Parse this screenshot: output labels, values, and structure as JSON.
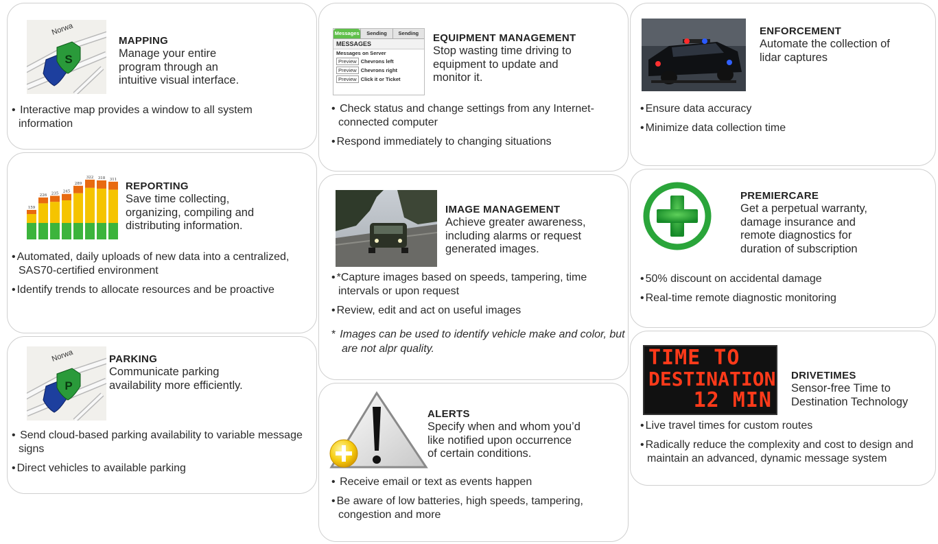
{
  "cards": {
    "mapping": {
      "title": "MAPPING",
      "desc": [
        "Manage your entire",
        "program through an",
        "intuitive visual interface."
      ],
      "map_label": "Norwa",
      "badge": "S",
      "bullets": [
        "Interactive map provides a window to all system information"
      ]
    },
    "reporting": {
      "title": "REPORTING",
      "desc": [
        "Save time collecting,",
        "organizing, compiling and",
        "distributing information."
      ],
      "bar_labels": [
        "159",
        "226",
        "235",
        "245",
        "289",
        "322",
        "318",
        "311"
      ],
      "bullets": [
        "Automated, daily uploads of new data into a centralized, SAS70-certified environment",
        "Identify trends to allocate resources and be proactive"
      ]
    },
    "parking": {
      "title": "PARKING",
      "desc": [
        "Communicate parking",
        "availability more efficiently."
      ],
      "map_label": "Norwa",
      "badge": "P",
      "bullets": [
        "Send cloud-based parking availability to variable message signs",
        "Direct vehicles to available parking"
      ]
    },
    "equipment": {
      "title": "EQUIPMENT MANAGEMENT",
      "desc": [
        "Stop wasting time driving to",
        "equipment to update and",
        "monitor it."
      ],
      "ui_tabs": [
        "Messages",
        "Sending",
        "Sending"
      ],
      "ui_header": "MESSAGES",
      "ui_subheader": "Messages on Server",
      "ui_preview": "Preview",
      "ui_rows": [
        "Chevrons left",
        "Chevrons right",
        "Click it or Ticket"
      ],
      "bullets": [
        "Check status and change settings from any Internet-connected computer",
        "Respond immediately to changing situations"
      ]
    },
    "image": {
      "title": "IMAGE MANAGEMENT",
      "desc": [
        "Achieve greater awareness,",
        "including alarms or request",
        "generated images."
      ],
      "bullets": [
        "*Capture images based on speeds, tampering, time intervals or upon request",
        "Review, edit and act on useful images"
      ],
      "note_mark": "*",
      "note": "Images can be used to identify vehicle make and color, but are not alpr quality."
    },
    "alerts": {
      "title": "ALERTS",
      "desc": [
        "Specify when and whom you’d",
        "like notified upon occurrence",
        "of certain conditions."
      ],
      "bullets": [
        "Receive email or text as events happen",
        "Be aware of low batteries, high speeds, tampering, congestion and more"
      ]
    },
    "enforcement": {
      "title": "ENFORCEMENT",
      "desc": [
        "Automate the collection of",
        "lidar captures"
      ],
      "bullets": [
        "Ensure data accuracy",
        "Minimize data collection time"
      ]
    },
    "premiercare": {
      "title": "PREMIERCARE",
      "desc": [
        "Get a perpetual warranty,",
        "damage insurance and",
        "remote diagnostics for",
        "duration of subscription"
      ],
      "bullets": [
        "50% discount on accidental damage",
        "Real-time remote diagnostic monitoring"
      ]
    },
    "drivetimes": {
      "title": "DRIVETIMES",
      "desc": [
        "Sensor-free Time to",
        "Destination Technology"
      ],
      "sign_lines": [
        "TIME TO",
        "DESTINATION",
        "12 MIN"
      ],
      "bullets": [
        "Live travel times for custom routes",
        "Radically reduce the complexity and cost to design and maintain an advanced, dynamic message system"
      ]
    }
  },
  "colors": {
    "border": "#cfcfcf",
    "text": "#2b2b2b",
    "badge_green": "#2a9a3a",
    "badge_blue": "#1d3f9e",
    "bar_green": "#3cb43c",
    "bar_yellow": "#f5c400",
    "bar_orange": "#e86a10",
    "plus_green": "#2aa53a",
    "sign_red": "#ff3a1a"
  }
}
